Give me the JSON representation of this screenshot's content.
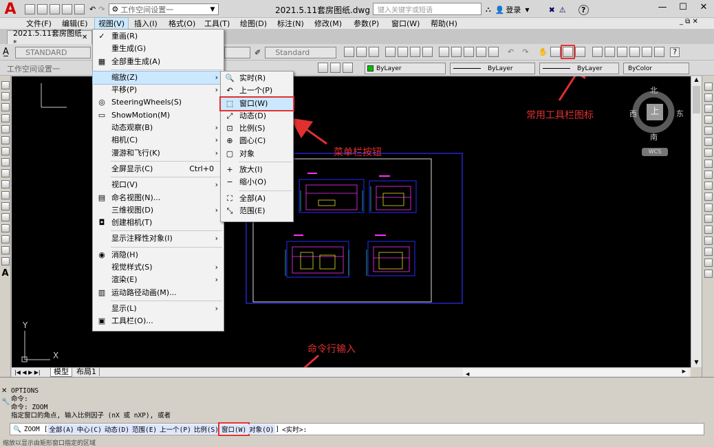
{
  "title": {
    "doc": "2021.5.11套房图纸.dwg",
    "workspace": "工作空间设置一",
    "search_placeholder": "键入关键字或短语",
    "login": "登录"
  },
  "menubar": [
    "文件(F)",
    "编辑(E)",
    "视图(V)",
    "插入(I)",
    "格式(O)",
    "工具(T)",
    "绘图(D)",
    "标注(N)",
    "修改(M)",
    "参数(P)",
    "窗口(W)",
    "帮助(H)"
  ],
  "tab": {
    "label": "2021.5.11套房图纸*"
  },
  "styles": {
    "text": "STANDARD",
    "dim": "Standard",
    "workspace": "工作空间设置一"
  },
  "props": {
    "layer": "ByLayer",
    "linetype": "ByLayer",
    "lineweight": "ByLayer",
    "color": "ByColor"
  },
  "view_menu": [
    {
      "icon": "✓",
      "label": "重画(R)"
    },
    {
      "label": "重生成(G)"
    },
    {
      "icon": "▦",
      "label": "全部重生成(A)"
    },
    {
      "sep": true
    },
    {
      "label": "缩放(Z)",
      "arrow": true,
      "active": true
    },
    {
      "label": "平移(P)",
      "arrow": true
    },
    {
      "icon": "◎",
      "label": "SteeringWheels(S)"
    },
    {
      "icon": "▭",
      "label": "ShowMotion(M)"
    },
    {
      "label": "动态观察(B)",
      "arrow": true
    },
    {
      "label": "相机(C)",
      "arrow": true
    },
    {
      "label": "漫游和飞行(K)",
      "arrow": true
    },
    {
      "sep": true
    },
    {
      "label": "全屏显示(C)",
      "shortcut": "Ctrl+0"
    },
    {
      "sep": true
    },
    {
      "label": "视口(V)",
      "arrow": true
    },
    {
      "icon": "▤",
      "label": "命名视图(N)..."
    },
    {
      "label": "三维视图(D)",
      "arrow": true
    },
    {
      "icon": "◘",
      "label": "创建相机(T)"
    },
    {
      "sep": true
    },
    {
      "label": "显示注释性对象(I)",
      "arrow": true
    },
    {
      "sep": true
    },
    {
      "icon": "◉",
      "label": "消隐(H)"
    },
    {
      "label": "视觉样式(S)",
      "arrow": true
    },
    {
      "label": "渲染(E)",
      "arrow": true
    },
    {
      "icon": "▥",
      "label": "运动路径动画(M)..."
    },
    {
      "sep": true
    },
    {
      "label": "显示(L)",
      "arrow": true
    },
    {
      "icon": "▣",
      "label": "工具栏(O)..."
    }
  ],
  "zoom_menu": [
    {
      "icon": "🔍",
      "label": "实时(R)"
    },
    {
      "icon": "↶",
      "label": "上一个(P)"
    },
    {
      "icon": "⬚",
      "label": "窗口(W)",
      "active": true
    },
    {
      "icon": "⤢",
      "label": "动态(D)"
    },
    {
      "icon": "⊡",
      "label": "比例(S)"
    },
    {
      "icon": "⊕",
      "label": "圆心(C)"
    },
    {
      "icon": "▢",
      "label": "对象"
    },
    {
      "sep": true
    },
    {
      "icon": "+",
      "label": "放大(I)"
    },
    {
      "icon": "−",
      "label": "缩小(O)"
    },
    {
      "sep": true
    },
    {
      "icon": "⛶",
      "label": "全部(A)"
    },
    {
      "icon": "⤡",
      "label": "范围(E)"
    }
  ],
  "annotations": {
    "toolbar": "常用工具栏图标",
    "menu": "菜单栏按钮",
    "cmdline": "命令行输入"
  },
  "viewcube": {
    "n": "北",
    "s": "南",
    "w": "西",
    "e": "东",
    "top": "上",
    "wcs": "WCS"
  },
  "layout_tabs": [
    "模型",
    "布局1"
  ],
  "cmd": {
    "lines": [
      "OPTIONS",
      "命令:",
      "命令: ZOOM",
      "指定窗口的角点, 输入比例因子 (nX 或 nXP), 或者"
    ],
    "zoom": "ZOOM",
    "bracket_open": "[",
    "opts": [
      "全部(A)",
      "中心(C)",
      "动态(D)",
      "范围(E)",
      "上一个(P)",
      "比例(S)",
      "窗口(W)",
      "对象(O)"
    ],
    "bracket_close": "]",
    "default": "<实时>:",
    "status": "缩放以显示由矩形窗口指定的区域"
  },
  "colors": {
    "accent": "#e03030",
    "menu_hl": "#cce8ff",
    "canvas": "#000000"
  }
}
